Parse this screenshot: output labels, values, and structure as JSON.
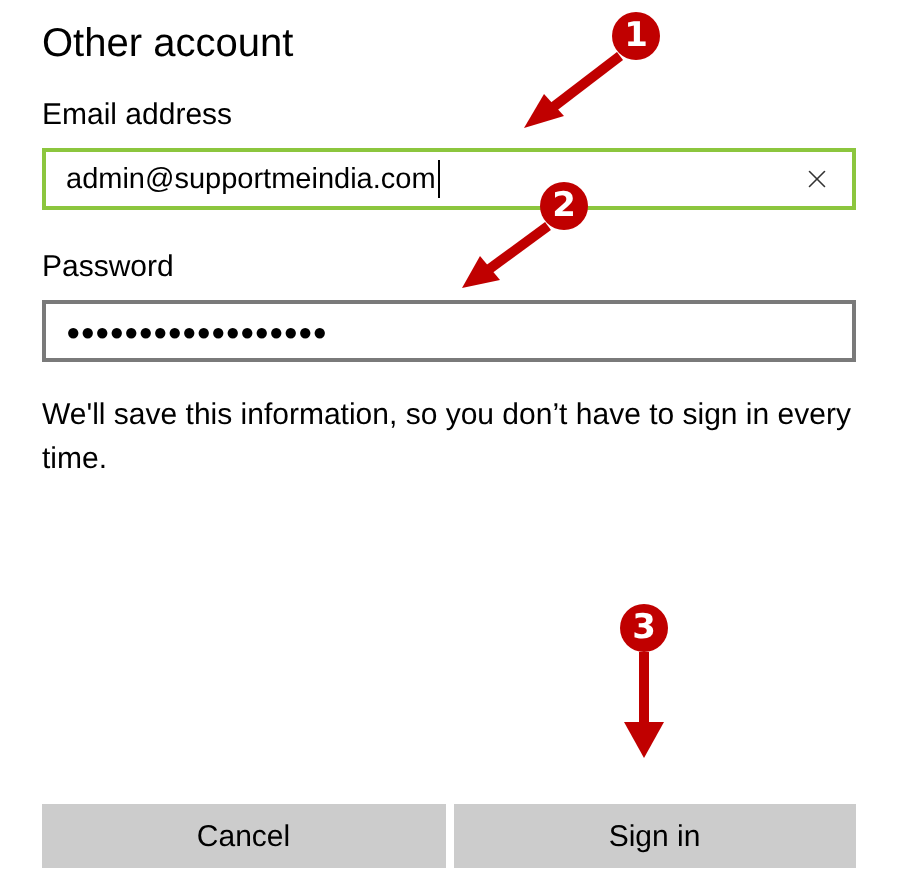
{
  "title": "Other account",
  "fields": [
    {
      "kind": "text",
      "label": "Email address",
      "value": "admin@supportmeindia.com",
      "focused": true,
      "clear_button": true
    },
    {
      "kind": "password",
      "label": "Password",
      "value": "●●●●●●●●●●●●●●●●●●",
      "focused": false,
      "clear_button": false
    }
  ],
  "note": "We'll save this information, so you don’t have to sign in every time.",
  "buttons": [
    "Cancel",
    "Sign in"
  ],
  "annotations": [
    {
      "label": "1"
    },
    {
      "label": "2"
    },
    {
      "label": "3"
    }
  ]
}
